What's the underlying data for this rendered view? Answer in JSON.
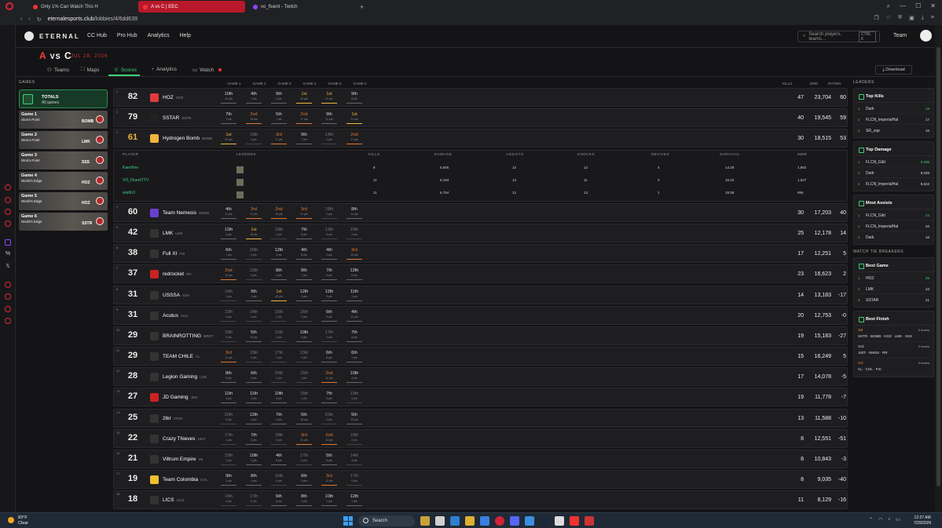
{
  "browser": {
    "tabs": [
      {
        "title": "Only 1% Can Watch This H"
      },
      {
        "title": "A vs C | EEC"
      },
      {
        "title": "vo_fluent - Twitch"
      }
    ],
    "new_tab": "+",
    "url_domain": "eternalesports.club",
    "url_path": "/lobbies/4/6dd639"
  },
  "nav": {
    "logo": "ETERNAL",
    "links": [
      "CC Hub",
      "Pro Hub",
      "Analytics",
      "Help"
    ],
    "search_placeholder": "Search players, teams...",
    "search_shortcut": "CTRL K",
    "team_label": "Team"
  },
  "match": {
    "team_a": "A",
    "vs": "VS",
    "team_c": "C",
    "date": "JUL 28, 2026"
  },
  "subnav": {
    "tabs": [
      "Teams",
      "Maps",
      "Scores",
      "Analytics",
      "Watch"
    ],
    "active": "Scores",
    "download": "Download"
  },
  "games": {
    "header": "GAMES",
    "totals_title": "TOTALS",
    "totals_sub": "All games",
    "list": [
      {
        "title": "Game 1",
        "map": "Storm Point",
        "winner": "BOMB"
      },
      {
        "title": "Game 2",
        "map": "Storm Point",
        "winner": "LMK"
      },
      {
        "title": "Game 3",
        "map": "Storm Point",
        "winner": "SSS"
      },
      {
        "title": "Game 4",
        "map": "World's Edge",
        "winner": "HOZ"
      },
      {
        "title": "Game 5",
        "map": "World's Edge",
        "winner": "HOZ"
      },
      {
        "title": "Game 6",
        "map": "World's Edge",
        "winner": "SSTR"
      }
    ]
  },
  "table_headers": {
    "games": [
      "GAME 1",
      "GAME 2",
      "GAME 3",
      "GAME 4",
      "GAME 5",
      "GAME 6"
    ],
    "kills": "KILLS",
    "dmg": "DMG",
    "rating": "RATING"
  },
  "rows": [
    {
      "rank": "1",
      "points": "82",
      "name": "HOZ",
      "tag": "HOZ",
      "kills": "47",
      "dmg": "23,704",
      "rating": "60",
      "games": [
        [
          "10th",
          "10 pts"
        ],
        [
          "4th",
          "7 pts"
        ],
        [
          "9th",
          "5 pts"
        ],
        [
          "1st",
          "25 pts"
        ],
        [
          "1st",
          "22 pts"
        ],
        [
          "9th",
          "8 pts"
        ]
      ]
    },
    {
      "rank": "2",
      "points": "79",
      "name": "SSTAR",
      "tag": "SSTR",
      "kills": "40",
      "dmg": "19,545",
      "rating": "59",
      "games": [
        [
          "7th",
          "7 pts"
        ],
        [
          "2nd",
          "16 pts"
        ],
        [
          "5th",
          "7 pts"
        ],
        [
          "2nd",
          "17 pts"
        ],
        [
          "9th",
          "11 pts"
        ],
        [
          "1st",
          "21 pts"
        ]
      ]
    },
    {
      "rank": "3",
      "points": "61",
      "name": "Hydrogen Bomb",
      "tag": "BOMB",
      "kills": "30",
      "dmg": "18,515",
      "rating": "53",
      "games": [
        [
          "1st",
          "24 pts"
        ],
        [
          "19th",
          "0 pts"
        ],
        [
          "3rd",
          "17 pts"
        ],
        [
          "9th",
          "7 pts"
        ],
        [
          "14th",
          "2 pts"
        ],
        [
          "2nd",
          "17 pts"
        ]
      ]
    },
    {
      "rank": "4",
      "points": "60",
      "name": "Team Nemesis",
      "tag": "NMSS",
      "kills": "30",
      "dmg": "17,203",
      "rating": "40",
      "games": [
        [
          "4th",
          "11 pts"
        ],
        [
          "3rd",
          "12 pts"
        ],
        [
          "2nd",
          "10 pts"
        ],
        [
          "3rd",
          "11 pts"
        ],
        [
          "18th",
          "2 pts"
        ],
        [
          "8th",
          "14 pts"
        ]
      ]
    },
    {
      "rank": "5",
      "points": "42",
      "name": "LMK",
      "tag": "LMK",
      "kills": "25",
      "dmg": "12,178",
      "rating": "14",
      "games": [
        [
          "12th",
          "4 pts"
        ],
        [
          "1st",
          "18 pts"
        ],
        [
          "19th",
          "0 pts"
        ],
        [
          "7th",
          "8 pts"
        ],
        [
          "13th",
          "5 pts"
        ],
        [
          "16th",
          "2 pts"
        ]
      ]
    },
    {
      "rank": "6",
      "points": "38",
      "name": "Full XI",
      "tag": "FXI",
      "kills": "17",
      "dmg": "12,251",
      "rating": "5",
      "games": [
        [
          "6th",
          "7 pts"
        ],
        [
          "20th",
          "0 pts"
        ],
        [
          "12th",
          "4 pts"
        ],
        [
          "4th",
          "8 pts"
        ],
        [
          "4th",
          "9 pts"
        ],
        [
          "3rd",
          "10 pts"
        ]
      ]
    },
    {
      "rank": "7",
      "points": "37",
      "name": "redrocket",
      "tag": "RR",
      "kills": "23",
      "dmg": "16,623",
      "rating": "2",
      "games": [
        [
          "2nd",
          "10 pts"
        ],
        [
          "13th",
          "5 pts"
        ],
        [
          "8th",
          "5 pts"
        ],
        [
          "8th",
          "7 pts"
        ],
        [
          "7th",
          "5 pts"
        ],
        [
          "12th",
          "5 pts"
        ]
      ]
    },
    {
      "rank": "8",
      "points": "31",
      "name": "USSSA",
      "tag": "SSS",
      "kills": "14",
      "dmg": "13,183",
      "rating": "-17",
      "games": [
        [
          "16th",
          "1 pts"
        ],
        [
          "9th",
          "2 pts"
        ],
        [
          "1st",
          "18 pts"
        ],
        [
          "12th",
          "4 pts"
        ],
        [
          "12th",
          "5 pts"
        ],
        [
          "11th",
          "1 pts"
        ]
      ]
    },
    {
      "rank": "9",
      "points": "31",
      "name": "Acutus",
      "tag": "ACU",
      "kills": "20",
      "dmg": "12,753",
      "rating": "-0",
      "games": [
        [
          "13th",
          "4 pts"
        ],
        [
          "14th",
          "4 pts"
        ],
        [
          "15th",
          "2 pts"
        ],
        [
          "16th",
          "2 pts"
        ],
        [
          "6th",
          "8 pts"
        ],
        [
          "4th",
          "11 pts"
        ]
      ]
    },
    {
      "rank": "10",
      "points": "29",
      "name": "BRAINROTTING",
      "tag": "BROT",
      "kills": "19",
      "dmg": "15,183",
      "rating": "-27",
      "games": [
        [
          "18th",
          "0 pts"
        ],
        [
          "5th",
          "10 pts"
        ],
        [
          "15th",
          "2 pts"
        ],
        [
          "10th",
          "5 pts"
        ],
        [
          "17th",
          "2 pts"
        ],
        [
          "7th",
          "8 pts"
        ]
      ]
    },
    {
      "rank": "11",
      "points": "29",
      "name": "TEAM CHILE",
      "tag": "CL",
      "kills": "15",
      "dmg": "16,249",
      "rating": "5",
      "games": [
        [
          "3rd",
          "12 pts"
        ],
        [
          "15th",
          "4 pts"
        ],
        [
          "17th",
          "1 pts"
        ],
        [
          "13th",
          "3 pts"
        ],
        [
          "6th",
          "8 pts"
        ],
        [
          "6th",
          "7 pts"
        ]
      ]
    },
    {
      "rank": "12",
      "points": "28",
      "name": "Legion Gaming",
      "tag": "LGN",
      "kills": "17",
      "dmg": "14,078",
      "rating": "-5",
      "games": [
        [
          "8th",
          "5 pts"
        ],
        [
          "6th",
          "5 pts"
        ],
        [
          "20th",
          "0 pts"
        ],
        [
          "15th",
          "4 pts"
        ],
        [
          "2nd",
          "12 pts"
        ],
        [
          "10th",
          "4 pts"
        ]
      ]
    },
    {
      "rank": "13",
      "points": "27",
      "name": "JD Gaming",
      "tag": "JDG",
      "kills": "19",
      "dmg": "11,778",
      "rating": "-7",
      "games": [
        [
          "11th",
          "4 pts"
        ],
        [
          "11th",
          "4 pts"
        ],
        [
          "10th",
          "5 pts"
        ],
        [
          "15th",
          "4 pts"
        ],
        [
          "7th",
          "8 pts"
        ],
        [
          "19th",
          "0 pts"
        ]
      ]
    },
    {
      "rank": "14",
      "points": "25",
      "name": "2tkr",
      "tag": "2TKR",
      "kills": "13",
      "dmg": "11,588",
      "rating": "-10",
      "games": [
        [
          "20th",
          "0 pts"
        ],
        [
          "12th",
          "4 pts"
        ],
        [
          "7th",
          "5 pts"
        ],
        [
          "5th",
          "10 pts"
        ],
        [
          "20th",
          "0 pts"
        ],
        [
          "5th",
          "10 pts"
        ]
      ]
    },
    {
      "rank": "15",
      "points": "22",
      "name": "Crazy Thieves",
      "tag": "100T",
      "kills": "8",
      "dmg": "12,551",
      "rating": "-51",
      "games": [
        [
          "17th",
          "1 pts"
        ],
        [
          "7th",
          "5 pts"
        ],
        [
          "18th",
          "0 pts"
        ],
        [
          "3rd",
          "11 pts"
        ],
        [
          "2nd",
          "13 pts"
        ],
        [
          "15th",
          "2 pts"
        ]
      ]
    },
    {
      "rank": "16",
      "points": "21",
      "name": "Viltrum Empire",
      "tag": "VE",
      "kills": "8",
      "dmg": "10,843",
      "rating": "-3",
      "games": [
        [
          "15th",
          "1 pts"
        ],
        [
          "10th",
          "2 pts"
        ],
        [
          "4th",
          "8 pts"
        ],
        [
          "17th",
          "6 pts"
        ],
        [
          "5th",
          "8 pts"
        ],
        [
          "14th",
          "3 pts"
        ]
      ]
    },
    {
      "rank": "17",
      "points": "19",
      "name": "Team Colombia",
      "tag": "COL",
      "kills": "8",
      "dmg": "9,035",
      "rating": "-40",
      "games": [
        [
          "9th",
          "2 pts"
        ],
        [
          "8th",
          "4 pts"
        ],
        [
          "16th",
          "0 pts"
        ],
        [
          "6th",
          "4 pts"
        ],
        [
          "3rd",
          "12 pts"
        ],
        [
          "17th",
          "0 pts"
        ]
      ]
    },
    {
      "rank": "18",
      "points": "18",
      "name": "LICS",
      "tag": "LICS",
      "kills": "11",
      "dmg": "8,129",
      "rating": "-16",
      "games": [
        [
          "14th",
          "2 pts"
        ],
        [
          "17th",
          "5 pts"
        ],
        [
          "6th",
          "8 pts"
        ],
        [
          "8th",
          "2 pts"
        ],
        [
          "10th",
          "1 pts"
        ],
        [
          "12th",
          "1 pts"
        ]
      ]
    }
  ],
  "expanded": {
    "headers": [
      "PLAYER",
      "LEGENDS",
      "KILLS",
      "DAMAGE",
      "ASSISTS",
      "KNOCKS",
      "REVIVES",
      "SURVIVAL",
      "MMR"
    ],
    "players": [
      {
        "name": "Kaen6ne",
        "kills": "8",
        "damage": "5,565",
        "assists": "12",
        "knocks": "12",
        "revives": "4",
        "survival": "14:29",
        "mmr": "1,882"
      },
      {
        "name": "VO_FluentTTV",
        "kills": "11",
        "damage": "6,184",
        "assists": "13",
        "knocks": "11",
        "revives": "2",
        "survival": "15:43",
        "mmr": "1,527"
      },
      {
        "name": "wiahh3",
        "kills": "11",
        "damage": "6,764",
        "assists": "12",
        "knocks": "13",
        "revives": "1",
        "survival": "15:08",
        "mmr": "956"
      }
    ]
  },
  "leaders": {
    "header": "LEADERS",
    "top_kills": {
      "title": "Top Kills",
      "items": [
        [
          "1",
          "Dark",
          "18"
        ],
        [
          "2",
          "FLCN_ImperialHal",
          "17"
        ],
        [
          "3",
          "SR_zap",
          "16"
        ]
      ]
    },
    "top_damage": {
      "title": "Top Damage",
      "items": [
        [
          "1",
          "FLCN_Gild",
          "9,296"
        ],
        [
          "2",
          "Dark",
          "9,038"
        ],
        [
          "3",
          "FLCN_ImperialHal",
          "8,622"
        ]
      ]
    },
    "most_assists": {
      "title": "Most Assists",
      "items": [
        [
          "1",
          "FLCN_Gild",
          "24"
        ],
        [
          "2",
          "FLCN_ImperialHal",
          "20"
        ],
        [
          "3",
          "Dark",
          "16"
        ]
      ]
    }
  },
  "tie_breakers": {
    "header": "MATCH TIE BREAKERS",
    "best_game": {
      "title": "Best Game",
      "items": [
        [
          "1",
          "HOZ",
          "25"
        ],
        [
          "2",
          "LMK",
          "23"
        ],
        [
          "3",
          "SSTAR",
          "21"
        ]
      ]
    },
    "best_finish": {
      "title": "Best Finish",
      "items": [
        {
          "place": "1st",
          "count": "5 teams",
          "teams": "SSTR · BOMB · HOZ · LMK · SSS"
        },
        {
          "place": "2nd",
          "count": "3 teams",
          "teams": "100T · NMSS · RR"
        },
        {
          "place": "3rd",
          "count": "3 teams",
          "teams": "CL · COL · FXI"
        }
      ]
    }
  },
  "taskbar": {
    "temp": "83°F",
    "weather": "Clear",
    "search": "Search",
    "time": "12:27 AM",
    "date": "7/29/2026"
  }
}
